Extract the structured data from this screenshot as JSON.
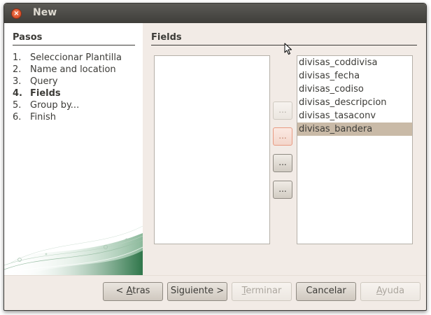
{
  "window": {
    "title": "New",
    "close_icon": "close-icon"
  },
  "steps": {
    "title": "Pasos",
    "items": [
      {
        "num": "1.",
        "label": "Seleccionar Plantilla"
      },
      {
        "num": "2.",
        "label": "Name and location"
      },
      {
        "num": "3.",
        "label": "Query"
      },
      {
        "num": "4.",
        "label": "Fields",
        "current": true
      },
      {
        "num": "5.",
        "label": "Group by..."
      },
      {
        "num": "6.",
        "label": "Finish"
      }
    ]
  },
  "content": {
    "title": "Fields",
    "available_fields": [],
    "selected_fields": [
      "divisas_coddivisa",
      "divisas_fecha",
      "divisas_codiso",
      "divisas_descripcion",
      "divisas_tasaconv",
      "divisas_bandera"
    ],
    "selected_index": 5,
    "move_buttons": [
      "...",
      "...",
      "...",
      "..."
    ]
  },
  "buttons": {
    "back": {
      "prefix": "< ",
      "mnemonic": "A",
      "rest": "tras"
    },
    "next": "Siguiente >",
    "finish": {
      "mnemonic": "T",
      "rest": "erminar"
    },
    "cancel": "Cancelar",
    "help": {
      "mnemonic": "A",
      "rest": "yuda"
    }
  },
  "colors": {
    "titlebar": "#4a4945",
    "dialog_bg": "#f2ebe6",
    "selection": "#c9baa7",
    "close_button": "#e2592f"
  }
}
